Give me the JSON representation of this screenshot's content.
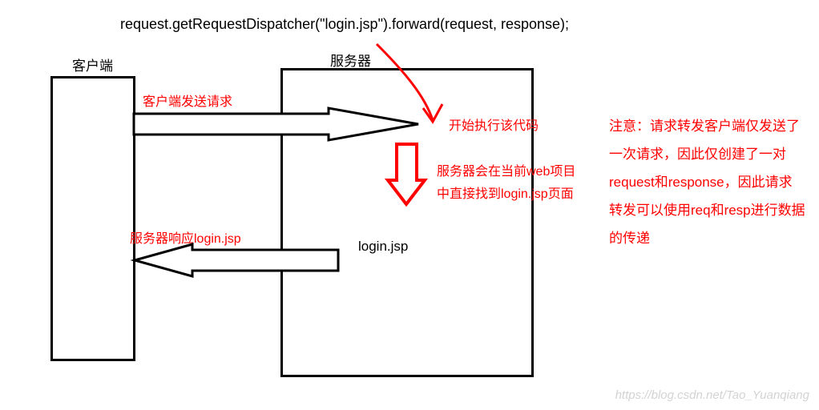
{
  "code": "request.getRequestDispatcher(\"login.jsp\").forward(request, response);",
  "labels": {
    "client": "客户端",
    "server": "服务器",
    "login": "login.jsp"
  },
  "annotations": {
    "request_sent": "客户端发送请求",
    "start_exec": "开始执行该代码",
    "find_line1": "服务器会在当前web项目",
    "find_line2": "中直接找到login.jsp页面",
    "response": "服务器响应login.jsp"
  },
  "note": "注意：请求转发客户端仅发送了一次请求，因此仅创建了一对request和response，因此请求转发可以使用req和resp进行数据的传递",
  "watermark": "https://blog.csdn.net/Tao_Yuanqiang"
}
